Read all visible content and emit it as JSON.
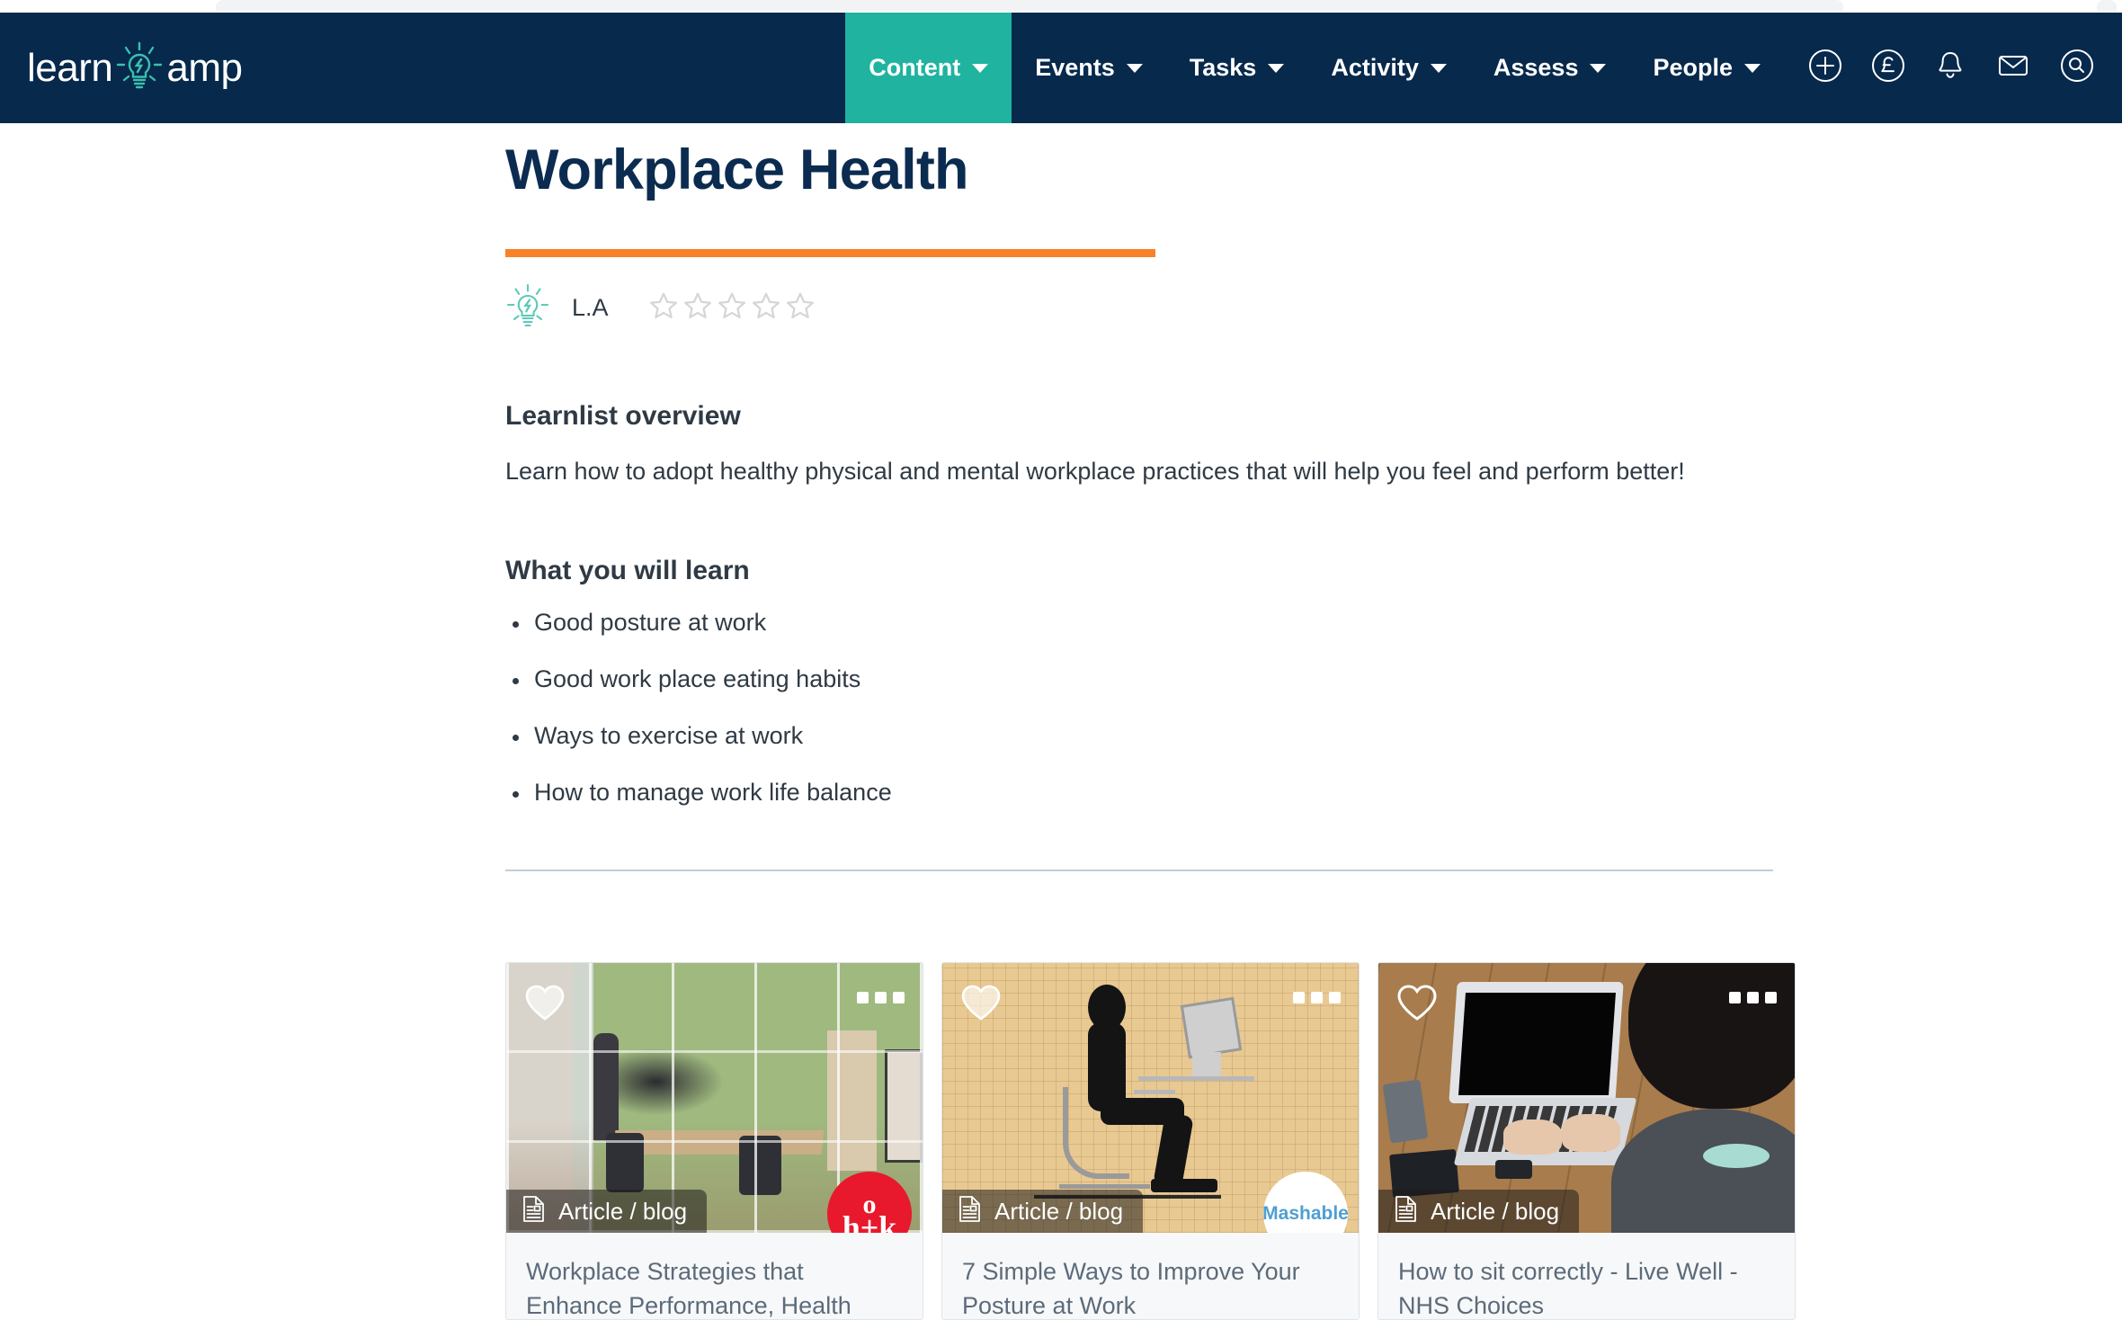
{
  "nav": {
    "logo": {
      "word_left": "learn",
      "word_right": "amp",
      "bulb_icon": "lightbulb-icon"
    },
    "items": [
      {
        "label": "Content",
        "active": true
      },
      {
        "label": "Events",
        "active": false
      },
      {
        "label": "Tasks",
        "active": false
      },
      {
        "label": "Activity",
        "active": false
      },
      {
        "label": "Assess",
        "active": false
      },
      {
        "label": "People",
        "active": false
      }
    ],
    "icons": [
      {
        "name": "add-circle-icon"
      },
      {
        "name": "pound-sterling-circle-icon"
      },
      {
        "name": "notifications-bell-icon"
      },
      {
        "name": "messages-envelope-icon"
      },
      {
        "name": "search-circle-icon"
      }
    ]
  },
  "page": {
    "title": "Workplace Health",
    "byline": {
      "icon": "lightbulb-icon",
      "author": "L.A",
      "rating": 0,
      "max_rating": 5
    },
    "overview_heading": "Learnlist overview",
    "overview_text": "Learn how to adopt healthy physical and mental workplace practices that will help you feel and perform better!",
    "learn_heading": "What you will learn",
    "learn_items": [
      "Good posture at work",
      "Good work place eating habits",
      "Ways to exercise at work",
      "How to manage work life balance"
    ]
  },
  "cards": [
    {
      "type_label": "Article / blog",
      "type_icon": "document-icon",
      "favorite_icon": "heart-icon",
      "menu_icon": "more-options-icon",
      "title": "Workplace Strategies that Enhance Performance, Health",
      "publisher_badge": "h+k",
      "image": "office-interior-photo"
    },
    {
      "type_label": "Article / blog",
      "type_icon": "document-icon",
      "favorite_icon": "heart-icon",
      "menu_icon": "more-options-icon",
      "title": "7 Simple Ways to Improve Your Posture at Work",
      "publisher_badge": "Mashable",
      "image": "sitting-posture-illustration"
    },
    {
      "type_label": "Article / blog",
      "type_icon": "document-icon",
      "favorite_icon": "heart-icon",
      "menu_icon": "more-options-icon",
      "title": "How to sit correctly - Live Well - NHS Choices",
      "publisher_badge": "",
      "image": "man-typing-laptop-photo"
    }
  ],
  "colors": {
    "nav_background": "#06294C",
    "nav_active": "#1FB3A0",
    "accent_teal": "#1FB3A0",
    "title_rule_orange": "#F98128",
    "title_text": "#0B2C50",
    "body_text": "#2F3A44",
    "card_title": "#5C6B7A",
    "card_background": "#F7F8F9",
    "divider": "#C3CDD6",
    "star_outline": "#D6D6D6",
    "badge_red": "#E8192C",
    "badge_mashable_text": "#4E9FD1"
  }
}
